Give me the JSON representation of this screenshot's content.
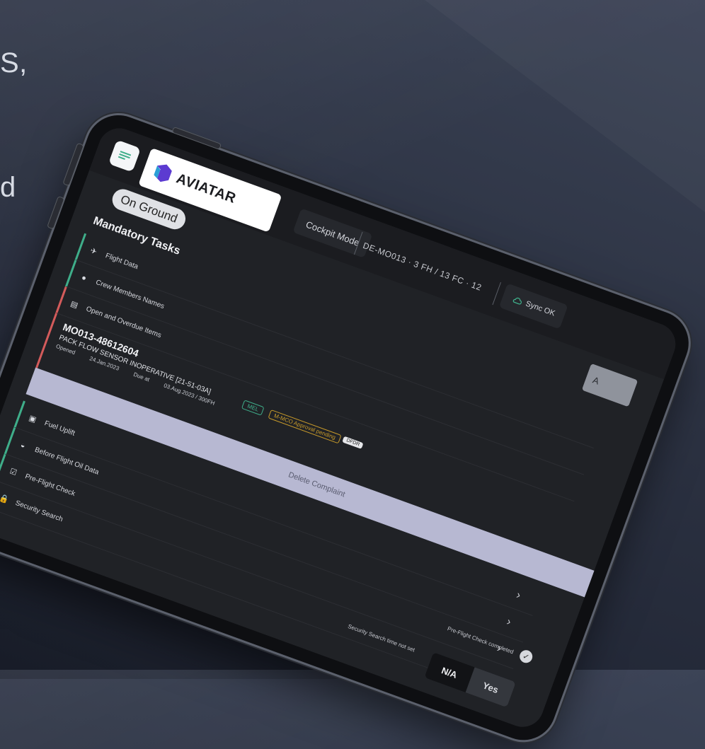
{
  "background": {
    "text_lines": [
      "S,",
      "d"
    ]
  },
  "header": {
    "app_name": "AVIATAR",
    "cockpit_mode": "Cockpit Mode",
    "flight_info": "DE-MO013 · 3 FH / 13 FC · 12",
    "sync_status": "Sync OK"
  },
  "status_pill": "On Ground",
  "section_title": "Mandatory Tasks",
  "tasks_top": [
    {
      "label": "Flight Data",
      "icon": "plane-icon",
      "status": "green"
    },
    {
      "label": "Crew Members Names",
      "icon": "crew-icon",
      "status": "green"
    },
    {
      "label": "Open and Overdue Items",
      "icon": "document-icon",
      "status": "red"
    }
  ],
  "open_item": {
    "id": "MO013-48612604",
    "description": "PACK FLOW SENSOR INOPERATIVE [21-51-03A]",
    "opened_label": "Opened",
    "opened_value": "24.Jan.2023",
    "due_label": "Due at",
    "due_value": "03.Aug.2023 / 300FH",
    "badge_1": "MEL",
    "badge_2": "M-MCO Approval pending",
    "badge_3": "DFDR"
  },
  "complete_bar_label": "Delete Complaint",
  "tasks_bottom": [
    {
      "label": "Fuel Uplift",
      "icon": "fuel-icon",
      "status": "green"
    },
    {
      "label": "Before Flight Oil Data",
      "icon": "oil-icon",
      "status": "green"
    },
    {
      "label": "Pre-Flight Check",
      "icon": "checklist-icon",
      "status": "green"
    },
    {
      "label": "Security Search",
      "icon": "lock-icon",
      "status": "green"
    }
  ],
  "add_button_label": "A",
  "preflight_checked_text": "Pre-Flight Check completed",
  "security_search_question": "Security Search time not set",
  "segmented": {
    "na": "N/A",
    "yes": "Yes"
  },
  "colors": {
    "accent_green": "#3fae8a",
    "alert_red": "#d35b5b",
    "complete_bar": "#b7b8d2",
    "screen_bg": "#202226"
  }
}
